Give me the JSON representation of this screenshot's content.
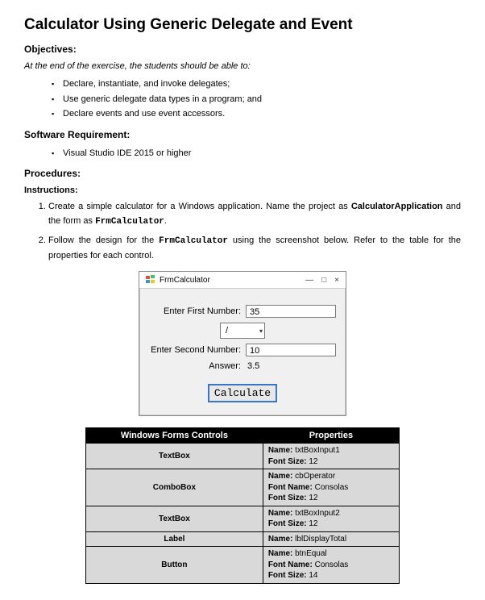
{
  "title": "Calculator Using Generic Delegate and Event",
  "sections": {
    "objectives_heading": "Objectives:",
    "objectives_intro": "At the end of the exercise, the students should be able to:",
    "objectives": [
      "Declare, instantiate, and invoke delegates;",
      "Use generic delegate data types in a program; and",
      "Declare events and use event accessors."
    ],
    "software_heading": "Software Requirement:",
    "software": [
      "Visual Studio IDE 2015 or higher"
    ],
    "procedures_heading": "Procedures:",
    "instructions_heading": "Instructions:",
    "step1_pre": "Create a simple calculator for a Windows application. Name the project as ",
    "step1_bold1": "CalculatorApplication",
    "step1_mid": " and the form as ",
    "step1_mono": "FrmCalculator",
    "step1_post": ".",
    "step2_pre": "Follow the design for the ",
    "step2_mono": "FrmCalculator",
    "step2_post": " using the screenshot below. Refer to the table for the properties for each control."
  },
  "form": {
    "title": "FrmCalculator",
    "label_first": "Enter First Number:",
    "value_first": "35",
    "operator_value": "/",
    "label_second": "Enter Second Number:",
    "value_second": "10",
    "label_answer": "Answer:",
    "value_answer": "3.5",
    "button_label": "Calculate",
    "win_min": "—",
    "win_max": "□",
    "win_close": "×"
  },
  "table": {
    "header_controls": "Windows Forms Controls",
    "header_props": "Properties",
    "rows": [
      {
        "control": "TextBox",
        "props": [
          {
            "key": "Name:",
            "val": " txtBoxInput1"
          },
          {
            "key": "Font Size:",
            "val": " 12"
          }
        ]
      },
      {
        "control": "ComboBox",
        "props": [
          {
            "key": "Name:",
            "val": " cbOperator"
          },
          {
            "key": "Font Name:",
            "val": " Consolas"
          },
          {
            "key": "Font Size:",
            "val": " 12"
          }
        ]
      },
      {
        "control": "TextBox",
        "props": [
          {
            "key": "Name:",
            "val": " txtBoxInput2"
          },
          {
            "key": "Font Size:",
            "val": " 12"
          }
        ]
      },
      {
        "control": "Label",
        "props": [
          {
            "key": "Name:",
            "val": " lblDisplayTotal"
          }
        ]
      },
      {
        "control": "Button",
        "props": [
          {
            "key": "Name:",
            "val": " btnEqual"
          },
          {
            "key": "Font Name:",
            "val": " Consolas"
          },
          {
            "key": "Font Size:",
            "val": " 14"
          }
        ]
      }
    ]
  }
}
